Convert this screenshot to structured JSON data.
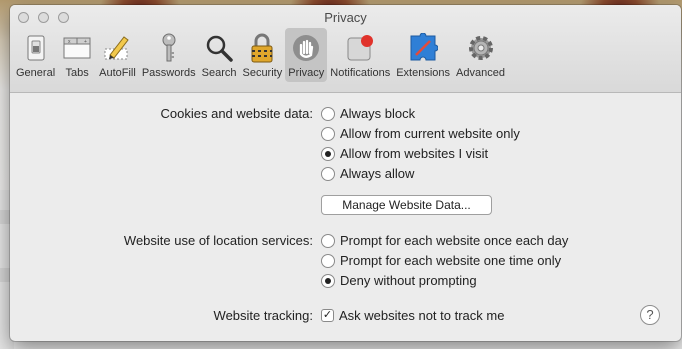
{
  "window": {
    "title": "Privacy"
  },
  "toolbar": {
    "items": [
      {
        "label": "General",
        "icon": "general-switch-icon"
      },
      {
        "label": "Tabs",
        "icon": "tabs-icon"
      },
      {
        "label": "AutoFill",
        "icon": "autofill-pencil-icon"
      },
      {
        "label": "Passwords",
        "icon": "key-icon"
      },
      {
        "label": "Search",
        "icon": "magnifier-icon"
      },
      {
        "label": "Security",
        "icon": "lock-icon"
      },
      {
        "label": "Privacy",
        "icon": "hand-icon",
        "selected": true
      },
      {
        "label": "Notifications",
        "icon": "notifications-icon"
      },
      {
        "label": "Extensions",
        "icon": "puzzle-icon"
      },
      {
        "label": "Advanced",
        "icon": "gear-icon"
      }
    ]
  },
  "cookies": {
    "label": "Cookies and website data:",
    "options": [
      "Always block",
      "Allow from current website only",
      "Allow from websites I visit",
      "Always allow"
    ],
    "selected": "Allow from websites I visit",
    "manage_button": "Manage Website Data..."
  },
  "location": {
    "label": "Website use of location services:",
    "options": [
      "Prompt for each website once each day",
      "Prompt for each website one time only",
      "Deny without prompting"
    ],
    "selected": "Deny without prompting"
  },
  "tracking": {
    "label": "Website tracking:",
    "checkbox_label": "Ask websites not to track me",
    "checked": true
  },
  "help": {
    "symbol": "?"
  }
}
